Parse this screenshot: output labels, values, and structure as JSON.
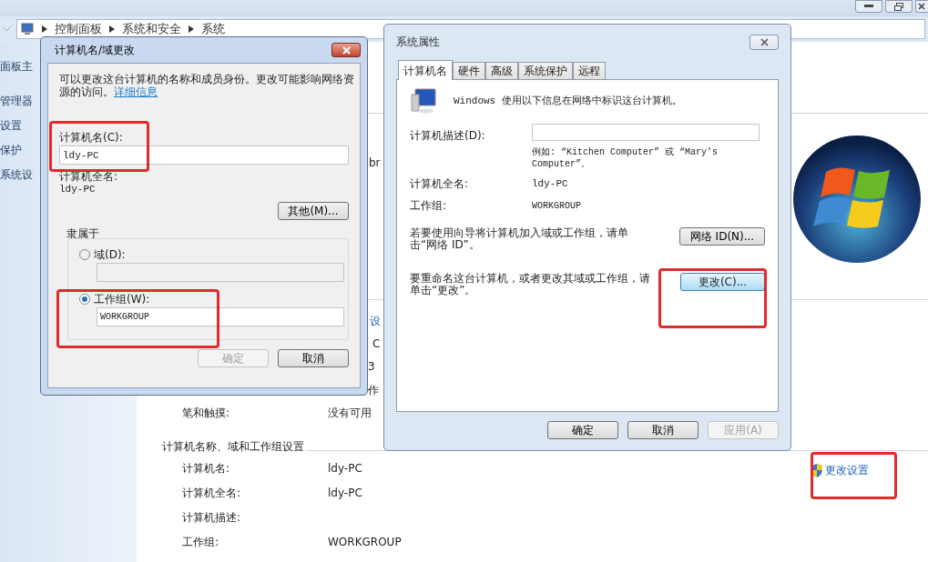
{
  "breadcrumb": [
    "控制面板",
    "系统和安全",
    "系统"
  ],
  "sidebar": {
    "items": [
      "面板主",
      "管理器",
      "设置",
      "保护",
      "系统设"
    ]
  },
  "background_fragments": [
    {
      "text": "br",
      "kind": "plain"
    },
    {
      "text": "设",
      "kind": "link"
    },
    {
      "text": "C",
      "kind": "plain"
    },
    {
      "text": "3",
      "kind": "plain"
    },
    {
      "text": "作",
      "kind": "plain"
    }
  ],
  "pen_touch": {
    "label": "笔和触摸:",
    "value": "没有可用"
  },
  "computer_section": {
    "heading": "计算机名称、域和工作组设置",
    "rows": [
      {
        "label": "计算机名:",
        "value": "ldy-PC"
      },
      {
        "label": "计算机全名:",
        "value": "ldy-PC"
      },
      {
        "label": "计算机描述:"
      },
      {
        "label": "工作组:",
        "value": "WORKGROUP"
      }
    ],
    "change_link": "更改设置"
  },
  "name_dialog": {
    "title": "计算机名/域更改",
    "intro": "可以更改这台计算机的名称和成员身份。更改可能影响网络资源的访问。",
    "link": "详细信息",
    "name_label": "计算机名(C):",
    "name_value": "ldy-PC",
    "full_name_label": "计算机全名:",
    "full_name_value": "ldy-PC",
    "more_button": "其他(M)...",
    "member_of": "隶属于",
    "options": [
      {
        "label": "域(D):",
        "selected": false
      },
      {
        "label": "工作组(W):",
        "selected": true,
        "value": "WORKGROUP"
      }
    ],
    "buttons": [
      {
        "label": "确定",
        "disabled": true
      },
      {
        "label": "取消",
        "disabled": false
      }
    ]
  },
  "props_dialog": {
    "title": "系统属性",
    "tabs": [
      {
        "label": "计算机名",
        "selected": true
      },
      {
        "label": "硬件",
        "selected": false
      },
      {
        "label": "高级",
        "selected": false
      },
      {
        "label": "系统保护",
        "selected": false
      },
      {
        "label": "远程",
        "selected": false
      }
    ],
    "intro": "Windows 使用以下信息在网络中标识这台计算机。",
    "desc_label": "计算机描述(D):",
    "example": "例如: “Kitchen Computer” 或 “Mary's Computer”。",
    "full_name_label": "计算机全名:",
    "full_name_value": "ldy-PC",
    "workgroup_label": "工作组:",
    "workgroup_value": "WORKGROUP",
    "network_text": "若要使用向导将计算机加入域或工作组，请单击“网络 ID”。",
    "network_button": "网络 ID(N)...",
    "rename_text": "要重命名这台计算机，或者更改其域或工作组，请单击“更改”。",
    "change_button": {
      "label": "更改(C)...",
      "focused": true
    },
    "buttons": [
      {
        "label": "确定",
        "disabled": false
      },
      {
        "label": "取消",
        "disabled": false
      },
      {
        "label": "应用(A)",
        "disabled": true
      }
    ]
  }
}
